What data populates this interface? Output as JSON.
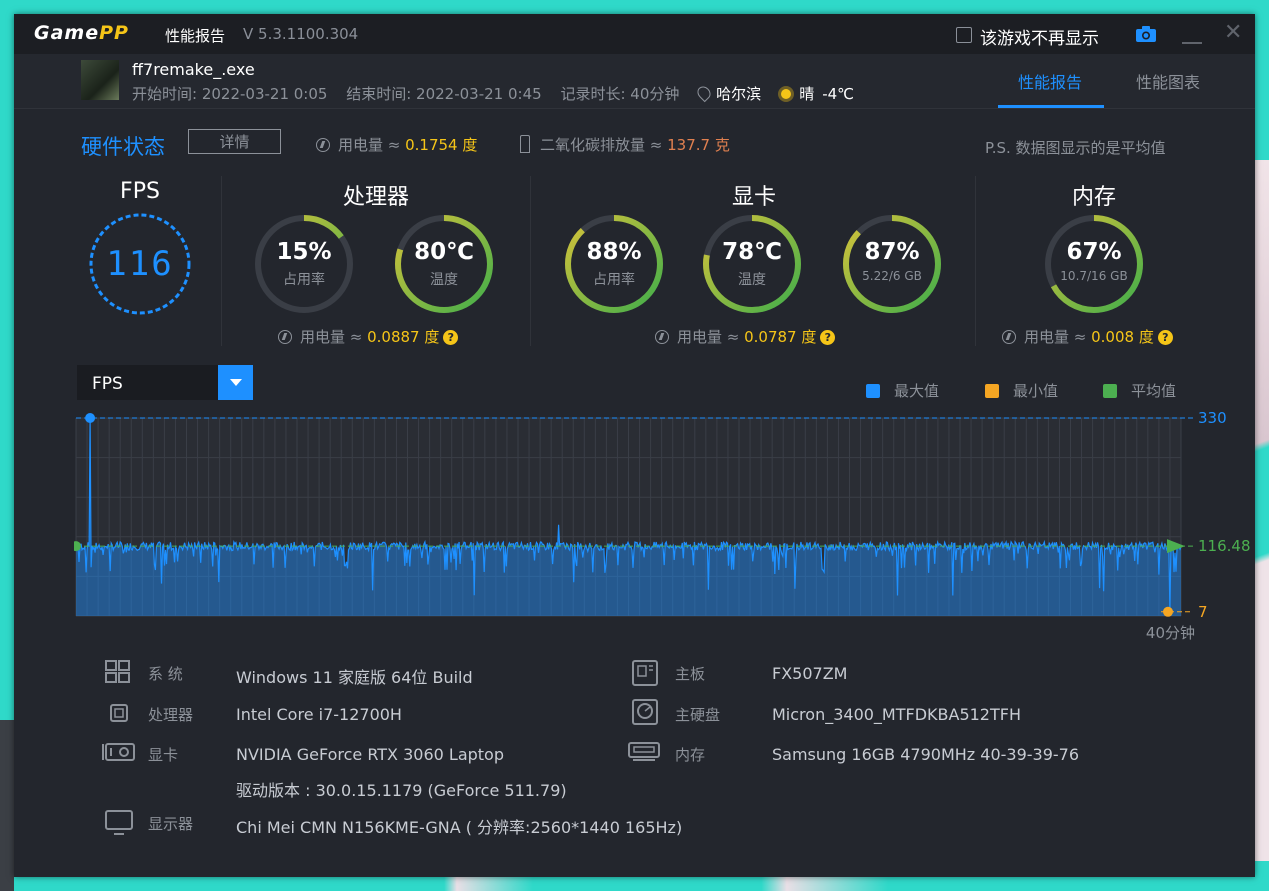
{
  "window": {
    "app_name": "GamePP",
    "title": "性能报告",
    "version": "V 5.3.1100.304",
    "hide_option": "该游戏不再显示"
  },
  "game": {
    "name": "ff7remake_.exe",
    "start": "开始时间: 2022-03-21 0:05",
    "end": "结束时间: 2022-03-21 0:45",
    "duration": "记录时长: 40分钟",
    "city": "哈尔滨",
    "weather": "晴",
    "temp": "-4℃"
  },
  "tabs": [
    {
      "label": "性能报告",
      "active": true
    },
    {
      "label": "性能图表",
      "active": false
    }
  ],
  "hardware": {
    "title": "硬件状态",
    "detail_button": "详情",
    "power_label": "用电量 ≈ ",
    "power_value": "0.1754 度",
    "co2_label": "二氧化碳排放量 ≈ ",
    "co2_value": "137.7 克",
    "note": "P.S. 数据图显示的是平均值"
  },
  "fps": {
    "title": "FPS",
    "value": "116"
  },
  "cpu": {
    "title": "处理器",
    "usage": {
      "value": "15%",
      "label": "占用率",
      "fraction": 0.15
    },
    "temp": {
      "value": "80℃",
      "label": "温度",
      "fraction": 0.8
    },
    "power_label": "用电量 ≈ ",
    "power_value": "0.0887 度"
  },
  "gpu": {
    "title": "显卡",
    "usage": {
      "value": "88%",
      "label": "占用率",
      "fraction": 0.88
    },
    "temp": {
      "value": "78℃",
      "label": "温度",
      "fraction": 0.78
    },
    "mem": {
      "value": "87%",
      "label": "5.22/6 GB",
      "fraction": 0.87
    },
    "power_label": "用电量 ≈ ",
    "power_value": "0.0787 度"
  },
  "memory": {
    "title": "内存",
    "usage": {
      "value": "67%",
      "label": "10.7/16 GB",
      "fraction": 0.67
    },
    "power_label": "用电量 ≈ ",
    "power_value": "0.008 度"
  },
  "chart_data": {
    "type": "area",
    "metric": "FPS",
    "series": [
      {
        "name": "最大值",
        "color": "#1e90ff",
        "value": 330
      },
      {
        "name": "最小值",
        "color": "#f5a623",
        "value": 7
      },
      {
        "name": "平均值",
        "color": "#4caf50",
        "value": 116.48
      }
    ],
    "y_labels": [
      "330",
      "116.48",
      "7"
    ],
    "x_end_label": "40分钟",
    "ylim": [
      0,
      330
    ],
    "grid": true
  },
  "specs": {
    "left": [
      {
        "label": "系 统",
        "value": "Windows 11 家庭版 64位   Build",
        "icon": "system-icon"
      },
      {
        "label": "处理器",
        "value": "Intel Core i7-12700H",
        "icon": "cpu-icon"
      },
      {
        "label": "显卡",
        "value": "NVIDIA GeForce RTX 3060 Laptop",
        "icon": "gpu-icon"
      },
      {
        "label": "",
        "value": "驱动版本 : 30.0.15.1179 (GeForce 511.79)",
        "icon": ""
      },
      {
        "label": "显示器",
        "value": "Chi Mei CMN N156KME-GNA ( 分辨率:2560*1440 165Hz)",
        "icon": "monitor-icon"
      }
    ],
    "right": [
      {
        "label": "主板",
        "value": "FX507ZM",
        "icon": "motherboard-icon"
      },
      {
        "label": "主硬盘",
        "value": "Micron_3400_MTFDKBA512TFH",
        "icon": "disk-icon"
      },
      {
        "label": "内存",
        "value": "Samsung 16GB 4790MHz 40-39-39-76",
        "icon": "ram-icon"
      }
    ]
  }
}
